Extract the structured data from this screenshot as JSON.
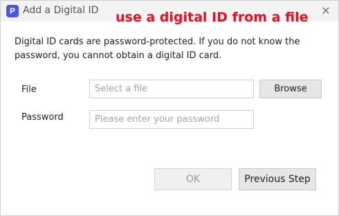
{
  "window": {
    "title": "Add a Digital ID",
    "app_icon_letter": "P",
    "close_glyph": "✕",
    "annotation": "use a digital ID from a file"
  },
  "description": "Digital ID cards are password-protected. If you do not know the password, you cannot obtain a digital ID card.",
  "form": {
    "file_label": "File",
    "file_placeholder": "Select a file",
    "file_value": "",
    "browse_label": "Browse",
    "password_label": "Password",
    "password_placeholder": "Please enter your password",
    "password_value": ""
  },
  "footer": {
    "ok_label": "OK",
    "previous_label": "Previous Step"
  },
  "icons": {
    "app": "pdf-app-icon",
    "close": "close-icon"
  }
}
